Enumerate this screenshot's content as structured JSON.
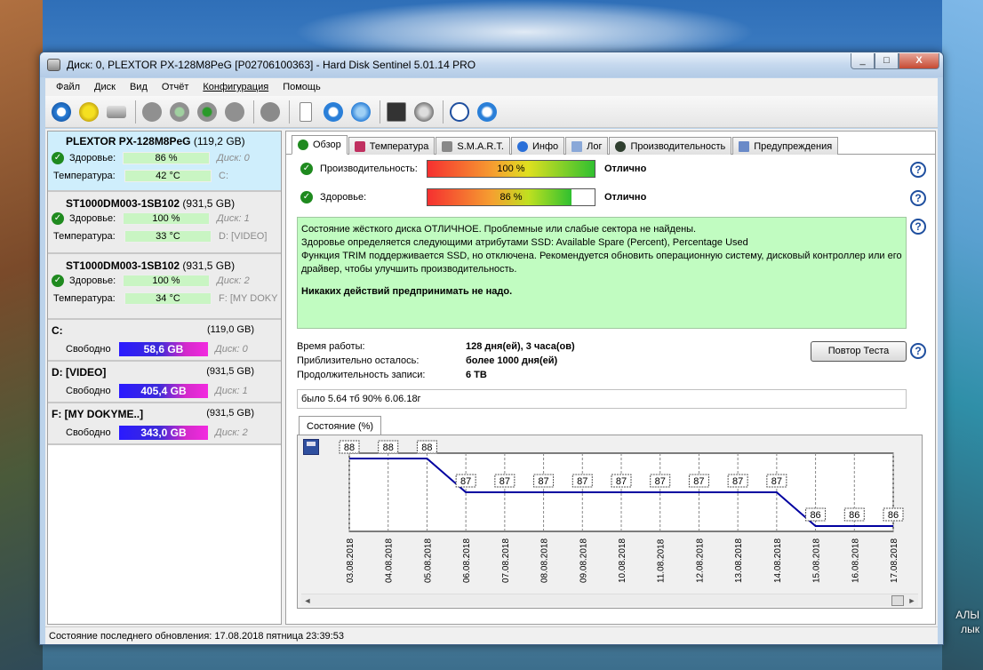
{
  "window": {
    "title": "Диск: 0, PLEXTOR PX-128M8PeG [P02706100363]  -  Hard Disk Sentinel 5.01.14 PRO",
    "min": "_",
    "max": "□",
    "close": "X"
  },
  "desktop": {
    "label1": "АЛЫ",
    "label2": "лык"
  },
  "menu": [
    "Файл",
    "Диск",
    "Вид",
    "Отчёт",
    "Конфигурация",
    "Помощь"
  ],
  "disks": [
    {
      "name": "PLEXTOR PX-128M8PeG",
      "size": "(119,2 GB)",
      "health_label": "Здоровье:",
      "health": "86 %",
      "disk_label": "Диск: 0",
      "temp_label": "Температура:",
      "temp": "42 °C",
      "volume": "C:"
    },
    {
      "name": "ST1000DM003-1SB102",
      "size": "(931,5 GB)",
      "health_label": "Здоровье:",
      "health": "100 %",
      "disk_label": "Диск: 1",
      "temp_label": "Температура:",
      "temp": "33 °C",
      "volume": "D: [VIDEO]"
    },
    {
      "name": "ST1000DM003-1SB102",
      "size": "(931,5 GB)",
      "health_label": "Здоровье:",
      "health": "100 %",
      "disk_label": "Диск: 2",
      "temp_label": "Температура:",
      "temp": "34 °C",
      "volume": "F: [MY DOKY"
    }
  ],
  "volumes": [
    {
      "name": "C:",
      "size": "(119,0 GB)",
      "free_label": "Свободно",
      "free": "58,6 GB",
      "free_fraction": 0.49,
      "disk": "Диск: 0"
    },
    {
      "name": "D: [VIDEO]",
      "size": "(931,5 GB)",
      "free_label": "Свободно",
      "free": "405,4 GB",
      "free_fraction": 0.44,
      "disk": "Диск: 1"
    },
    {
      "name": "F: [MY DOKYME..]",
      "size": "(931,5 GB)",
      "free_label": "Свободно",
      "free": "343,0 GB",
      "free_fraction": 0.37,
      "disk": "Диск: 2"
    }
  ],
  "tabs": [
    "Обзор",
    "Температура",
    "S.M.A.R.T.",
    "Инфо",
    "Лог",
    "Производительность",
    "Предупреждения"
  ],
  "performance": {
    "label": "Производительность:",
    "value": "100 %",
    "fraction": 1.0,
    "status": "Отлично"
  },
  "health": {
    "label": "Здоровье:",
    "value": "86 %",
    "fraction": 0.86,
    "status": "Отлично"
  },
  "status_text": {
    "line1": "Состояние жёсткого диска ОТЛИЧНОЕ. Проблемные или слабые сектора не найдены.",
    "line2": "Здоровье определяется следующими атрибутами SSD: Available Spare (Percent), Percentage Used",
    "line3": "Функция TRIM поддерживается SSD, но отключена. Рекомендуется обновить операционную систему, дисковый контроллер или его драйвер, чтобы улучшить производительность.",
    "line4": "Никаких действий предпринимать не надо."
  },
  "info": [
    {
      "key": "Время работы:",
      "value": "128 дня(ей), 3 часа(ов)"
    },
    {
      "key": "Приблизительно осталось:",
      "value": "более 1000 дня(ей)"
    },
    {
      "key": "Продолжительность записи:",
      "value": "6 TB"
    }
  ],
  "retest_label": "Повтор Теста",
  "note": "было 5.64 тб 90% 6.06.18г",
  "chart_tab": "Состояние (%)",
  "help_glyph": "?",
  "statusbar": "Состояние последнего обновления: 17.08.2018 пятница 23:39:53",
  "chart_data": {
    "type": "line",
    "categories": [
      "03.08.2018",
      "04.08.2018",
      "05.08.2018",
      "06.08.2018",
      "07.08.2018",
      "08.08.2018",
      "09.08.2018",
      "10.08.2018",
      "11.08.2018",
      "12.08.2018",
      "13.08.2018",
      "14.08.2018",
      "15.08.2018",
      "16.08.2018",
      "17.08.2018"
    ],
    "values": [
      88,
      88,
      88,
      87,
      87,
      87,
      87,
      87,
      87,
      87,
      87,
      87,
      86,
      86,
      86
    ],
    "grid": true,
    "color": "#0000a0"
  }
}
